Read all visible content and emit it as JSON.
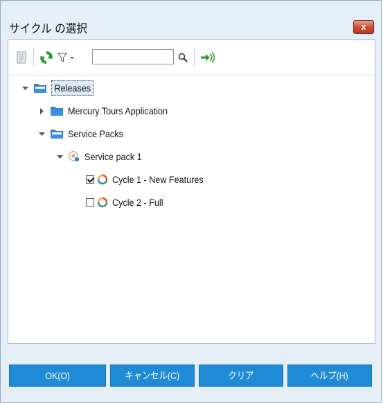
{
  "window": {
    "title": "サイクル の選択",
    "close_label": "x"
  },
  "toolbar": {
    "search_value": ""
  },
  "tree": {
    "releases": "Releases",
    "mercury": "Mercury Tours Application",
    "service_packs": "Service Packs",
    "service_pack_1": "Service pack 1",
    "cycle1": "Cycle 1 - New Features",
    "cycle2": "Cycle 2 - Full",
    "cycle1_checked": true,
    "cycle2_checked": false
  },
  "buttons": {
    "ok": "OK(O)",
    "cancel": "キャンセル(C)",
    "clear": "クリア",
    "help": "ヘルプ(H)"
  },
  "colors": {
    "button": "#1f8ad5",
    "folder": "#2f7fd0"
  }
}
